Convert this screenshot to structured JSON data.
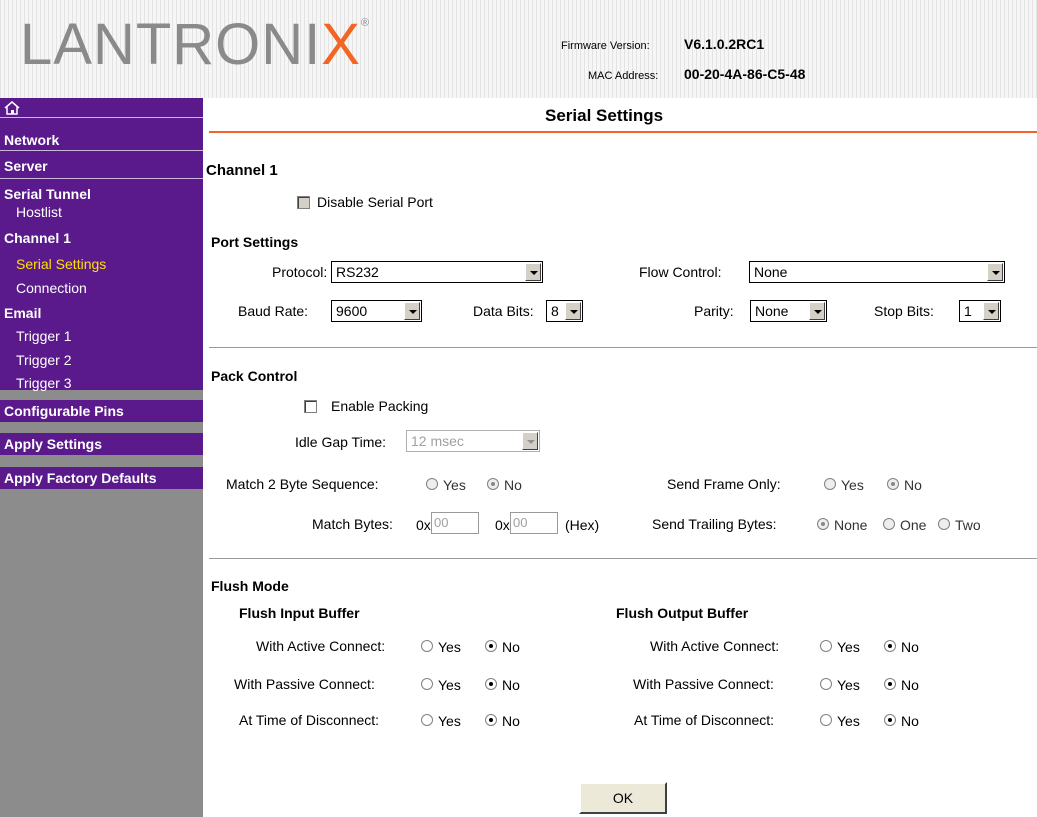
{
  "header": {
    "logo": {
      "text": "LANTRONI",
      "x_letter": "X",
      "reg": "®"
    },
    "firmware_label": "Firmware Version:",
    "firmware_value": "V6.1.0.2RC1",
    "mac_label": "MAC Address:",
    "mac_value": "00-20-4A-86-C5-48"
  },
  "sidebar": {
    "home_icon": "home-icon",
    "items": [
      {
        "label": "Network"
      },
      {
        "label": "Server"
      },
      {
        "label": "Serial Tunnel"
      },
      {
        "label": "Hostlist"
      },
      {
        "label": "Channel 1"
      },
      {
        "label": "Serial Settings"
      },
      {
        "label": "Connection"
      },
      {
        "label": "Email"
      },
      {
        "label": "Trigger 1"
      },
      {
        "label": "Trigger 2"
      },
      {
        "label": "Trigger 3"
      },
      {
        "label": "Configurable Pins"
      },
      {
        "label": "Apply Settings"
      },
      {
        "label": "Apply Factory Defaults"
      }
    ]
  },
  "page": {
    "title": "Serial Settings",
    "channel": "Channel 1",
    "disable_serial_port": "Disable Serial Port",
    "port_settings": {
      "heading": "Port Settings",
      "protocol_label": "Protocol:",
      "protocol_value": "RS232",
      "flow_control_label": "Flow Control:",
      "flow_control_value": "None",
      "baud_rate_label": "Baud Rate:",
      "baud_rate_value": "9600",
      "data_bits_label": "Data Bits:",
      "data_bits_value": "8",
      "parity_label": "Parity:",
      "parity_value": "None",
      "stop_bits_label": "Stop Bits:",
      "stop_bits_value": "1"
    },
    "pack_control": {
      "heading": "Pack Control",
      "enable_packing": "Enable Packing",
      "idle_gap_label": "Idle Gap Time:",
      "idle_gap_value": "12 msec",
      "match2_label": "Match 2 Byte Sequence:",
      "send_frame_label": "Send Frame Only:",
      "match_bytes_label": "Match Bytes:",
      "hex_prefix": "0x",
      "match_byte_1": "00",
      "match_byte_2": "00",
      "hex_suffix": "(Hex)",
      "send_trailing_label": "Send Trailing Bytes:",
      "yes": "Yes",
      "no": "No",
      "none": "None",
      "one": "One",
      "two": "Two"
    },
    "flush_mode": {
      "heading": "Flush Mode",
      "input_heading": "Flush Input Buffer",
      "output_heading": "Flush Output Buffer",
      "active": "With Active Connect:",
      "passive": "With Passive Connect:",
      "disconnect": "At Time of Disconnect:",
      "yes": "Yes",
      "no": "No"
    },
    "ok_label": "OK"
  }
}
